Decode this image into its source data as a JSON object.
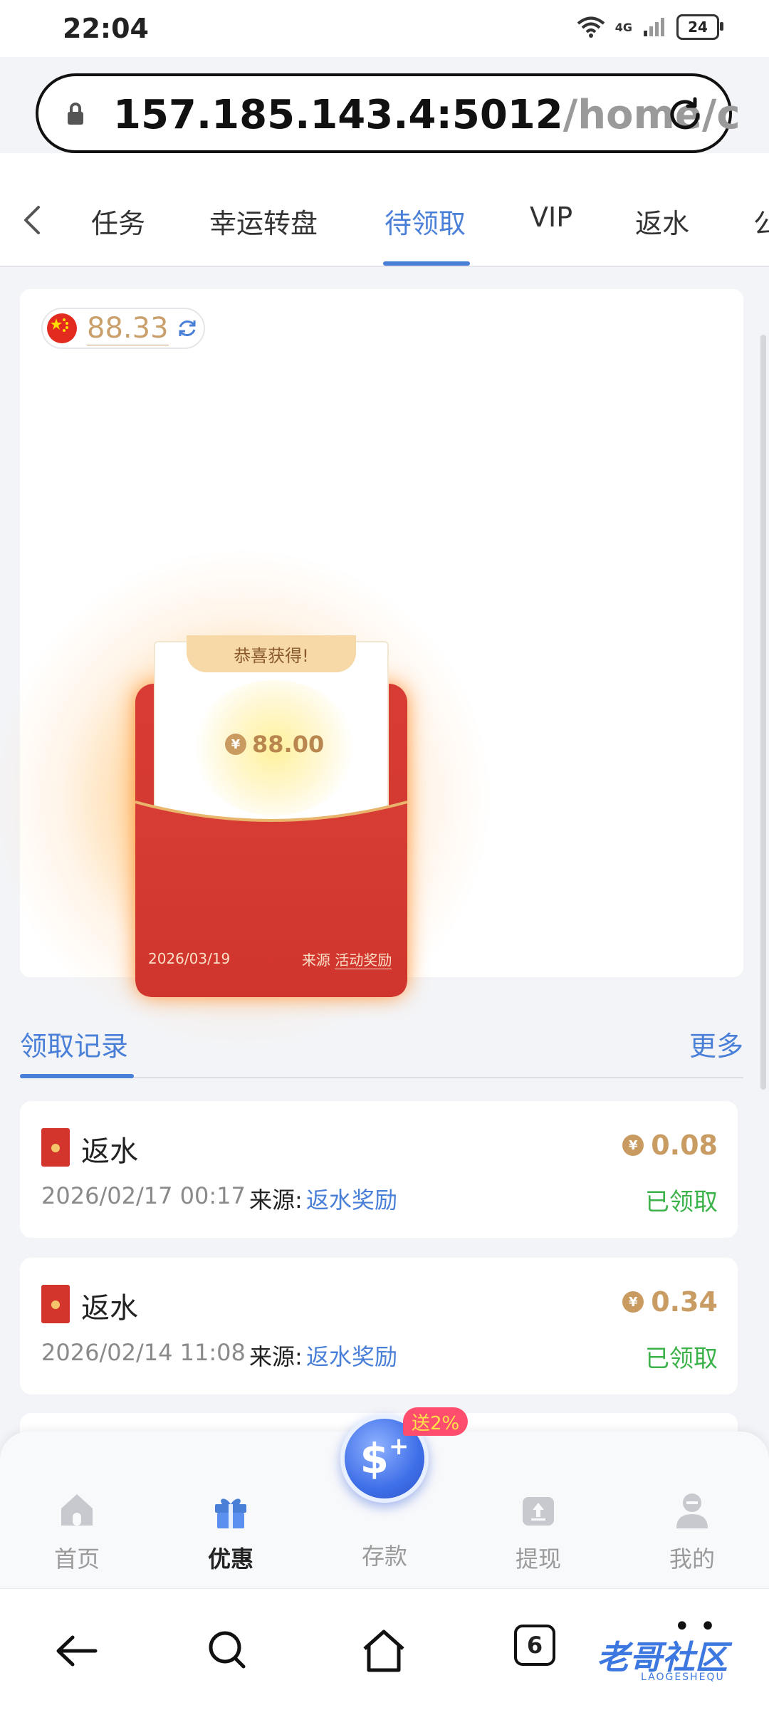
{
  "status_bar": {
    "time": "22:04",
    "network": "4G",
    "battery": "24"
  },
  "browser": {
    "url_host": "157.185.143.4:5012",
    "url_path": "/home/c"
  },
  "tabs": [
    {
      "label": "任务"
    },
    {
      "label": "幸运转盘"
    },
    {
      "label": "待领取",
      "active": true
    },
    {
      "label": "VIP"
    },
    {
      "label": "返水"
    },
    {
      "label": "公"
    }
  ],
  "balance": {
    "value": "88.33",
    "flag": "china-flag-icon"
  },
  "red_packet": {
    "congrats": "恭喜获得!",
    "amount": "88.00",
    "currency_symbol": "¥",
    "date": "2026/03/19",
    "source_label": "来源",
    "source_value": "活动奖励"
  },
  "records": {
    "title": "领取记录",
    "more": "更多",
    "items": [
      {
        "name": "返水",
        "amount": "0.08",
        "date": "2026/02/17 00:17",
        "source_label": "来源:",
        "source": "返水奖励",
        "status": "已领取"
      },
      {
        "name": "返水",
        "amount": "0.34",
        "date": "2026/02/14 11:08",
        "source_label": "来源:",
        "source": "返水奖励",
        "status": "已领取"
      }
    ]
  },
  "bottom_nav": {
    "items": [
      {
        "label": "首页",
        "icon": "home-icon"
      },
      {
        "label": "优惠",
        "icon": "gift-icon",
        "active": true
      },
      {
        "label": "存款",
        "icon": "deposit-icon"
      },
      {
        "label": "提现",
        "icon": "withdraw-icon"
      },
      {
        "label": "我的",
        "icon": "profile-icon"
      }
    ],
    "bonus_badge": "送2%"
  },
  "system_nav": {
    "tab_count": "6",
    "watermark": "老哥社区",
    "watermark_sub": "LAOGESHEQU"
  },
  "colors": {
    "accent": "#4a7fd8",
    "gold": "#c89c63",
    "success": "#3cb34a",
    "packet_red": "#d3342b"
  }
}
